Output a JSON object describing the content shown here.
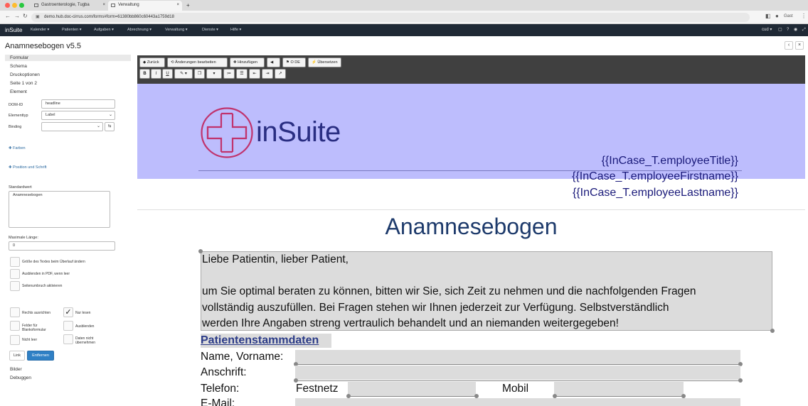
{
  "browser": {
    "tabs": [
      {
        "label": "Gastroenterologie, Tugba",
        "close": "×"
      },
      {
        "label": "Verwaltung",
        "close": "×"
      }
    ],
    "new_tab": "+",
    "url": "demo.hub.doc-cirrus.com/forms#form=61380bb860c60443a1759d18",
    "guest": "Gast"
  },
  "appnav": {
    "brand": "inSuite",
    "menu": [
      "Kalender ▾",
      "Patienten ▾",
      "Aufgaben ▾",
      "Abrechnung ▾",
      "Verwaltung ▾",
      "Dienste ▾",
      "Hilfe ▾"
    ],
    "right": "cud ▾"
  },
  "page": {
    "title": "Anamnesebogen v5.5",
    "back": "‹",
    "close": "×"
  },
  "sidebar": {
    "items": [
      "Formular",
      "Schema",
      "Druckoptionen",
      "Seite 1 von 2",
      "Element"
    ],
    "domid_label": "DOM-ID",
    "domid_value": "headline",
    "elementtyp_label": "Elementtyp",
    "elementtyp_value": "Label",
    "binding_label": "Binding",
    "binding_value": "",
    "farben": "✚ Farben",
    "position_schrift": "✚ Position und Schrift",
    "standardwert_label": "Standardwert",
    "standardwert_value": "Anamnesebogen",
    "maxlen_label": "Maximale Länge:",
    "maxlen_value": "0",
    "checks1": [
      "Größe des Textes beim Überlauf ändern",
      "Ausblenden in PDF, wenn leer",
      "Seitenumbruch aktivieren"
    ],
    "checks_left": [
      "Rechts ausrichten",
      "Felder für Blankoformular",
      "Nicht leer"
    ],
    "checks_right": [
      "Nur lesen",
      "Ausblenden",
      "Daten nicht übernehmen"
    ],
    "link_btn": "Link",
    "remove_btn": "Entfernen",
    "bilder": "Bilder",
    "debuggen": "Debuggen"
  },
  "toolbar": {
    "zurueck": "◆ Zurück",
    "aenderungen": "⟲ Änderungen bearbeiten",
    "hinzufuegen": "✚ Hinzufügen",
    "send": "◀",
    "lang": "⚑ O DE",
    "uebersetzen": "⚡ Übersetzen",
    "format": [
      "B",
      "I",
      "U",
      "✎ ▾",
      "❐",
      "▾",
      "≔",
      "☰",
      "⇤",
      "⇥",
      "↗"
    ]
  },
  "document": {
    "logo_text": "inSuite",
    "employee_title": "{{InCase_T.employeeTitle}}",
    "employee_firstname": "{{InCase_T.employeeFirstname}}",
    "employee_lastname": "{{InCase_T.employeeLastname}}",
    "title": "Anamnesebogen",
    "greeting": "Liebe Patientin, lieber Patient,",
    "intro_lines": [
      "um Sie optimal beraten zu können, bitten wir Sie, sich Zeit zu nehmen und die nachfolgenden Fragen",
      "vollständig auszufüllen. Bei Fragen stehen wir Ihnen jederzeit zur Verfügung. Selbstverständlich",
      "werden Ihre Angaben streng vertraulich behandelt und an niemanden weitergegeben!"
    ],
    "section_title": "Patientenstammdaten",
    "name_label": "Name, Vorname:",
    "address_label": "Anschrift:",
    "phone_label": "Telefon:",
    "festnetz_label": "Festnetz",
    "mobil_label": "Mobil",
    "email_label": "E-Mail:"
  },
  "colors": {
    "nav_bg": "#1f2935",
    "banner_bg": "#bdbdfd",
    "logo_cross": "#c0336d",
    "title_blue": "#1d3a6b",
    "primary_button": "#2f80c5"
  }
}
